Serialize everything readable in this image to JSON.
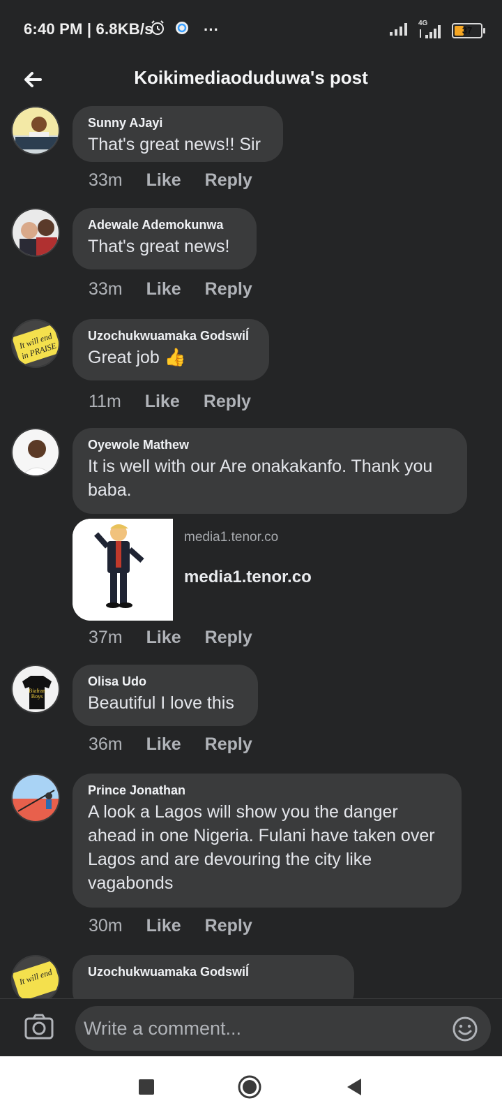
{
  "status_bar": {
    "time_speed": "6:40 PM | 6.8KB/s",
    "more": "···",
    "network": "4G",
    "battery": "37",
    "battery_level": 0.37
  },
  "header": {
    "title": "Koikimediaoduduwa's post"
  },
  "comments": [
    {
      "author": "Sunny AJayi",
      "text": "That's great news!! Sir",
      "time": "33m",
      "like": "Like",
      "reply": "Reply"
    },
    {
      "author": "Adewale Ademokunwa",
      "text": "That's great news!",
      "time": "33m",
      "like": "Like",
      "reply": "Reply"
    },
    {
      "author": "Uzochukwuamaka Godswiĺ",
      "text": "Great job 👍",
      "time": "11m",
      "like": "Like",
      "reply": "Reply"
    },
    {
      "author": "Oyewole Mathew",
      "text": "It is well with our Are onakakanfo. Thank you baba.",
      "time": "37m",
      "like": "Like",
      "reply": "Reply",
      "link": {
        "domain": "media1.tenor.co",
        "title": "media1.tenor.co"
      }
    },
    {
      "author": "Olisa Udo",
      "text": "Beautiful I love this",
      "time": "36m",
      "like": "Like",
      "reply": "Reply"
    },
    {
      "author": "Prince Jonathan",
      "text": "A look a Lagos will show you the danger ahead in one Nigeria. Fulani have taken over Lagos and are devouring the city like vagabonds",
      "time": "30m",
      "like": "Like",
      "reply": "Reply"
    },
    {
      "author": "Uzochukwuamaka Godswiĺ"
    }
  ],
  "composer": {
    "placeholder": "Write a comment..."
  }
}
